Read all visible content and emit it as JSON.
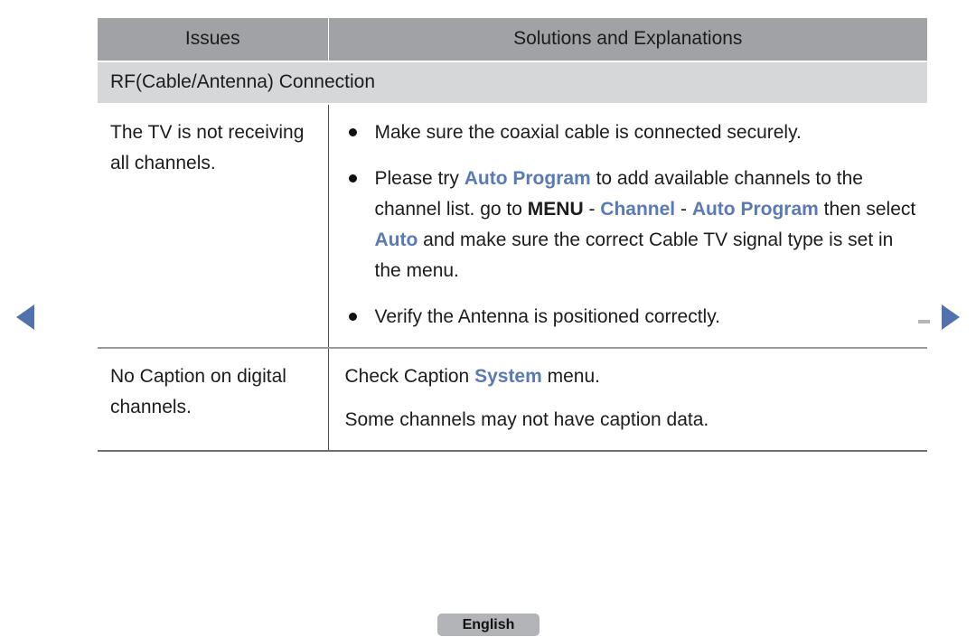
{
  "table": {
    "columns": [
      {
        "id": "issues",
        "label": "Issues"
      },
      {
        "id": "solutions",
        "label": "Solutions and Explanations"
      }
    ],
    "section_heading": "RF(Cable/Antenna) Connection",
    "rows": [
      {
        "issue": "The TV is not receiving all channels.",
        "solution_type": "bullets",
        "bullets": [
          {
            "segments": [
              {
                "text": "Make sure the coaxial cable is connected securely.",
                "style": "normal"
              }
            ]
          },
          {
            "segments": [
              {
                "text": "Please try ",
                "style": "normal"
              },
              {
                "text": "Auto Program",
                "style": "blue-bold"
              },
              {
                "text": " to add available channels to the channel list. go to ",
                "style": "normal"
              },
              {
                "text": "MENU",
                "style": "black-bold"
              },
              {
                "text": " - ",
                "style": "normal"
              },
              {
                "text": "Channel",
                "style": "blue-bold"
              },
              {
                "text": " - ",
                "style": "normal"
              },
              {
                "text": "Auto Program",
                "style": "blue-bold"
              },
              {
                "text": " then select ",
                "style": "normal"
              },
              {
                "text": "Auto",
                "style": "blue-bold"
              },
              {
                "text": " and make sure the correct Cable TV signal type is set in the menu.",
                "style": "normal"
              }
            ]
          },
          {
            "segments": [
              {
                "text": "Verify the Antenna is positioned correctly.",
                "style": "normal"
              }
            ]
          }
        ]
      },
      {
        "issue": "No Caption on digital channels.",
        "solution_type": "lines",
        "lines": [
          {
            "segments": [
              {
                "text": "Check Caption ",
                "style": "normal"
              },
              {
                "text": "System",
                "style": "blue-bold"
              },
              {
                "text": " menu.",
                "style": "normal"
              }
            ]
          },
          {
            "segments": [
              {
                "text": "Some channels may not have caption data.",
                "style": "normal"
              }
            ]
          }
        ]
      }
    ]
  },
  "navigation": {
    "prev_label": "◀",
    "next_label": "▶"
  },
  "footer": {
    "language_label": "English"
  },
  "colors": {
    "header_bg": "#a0a2a6",
    "subheader_bg": "#d6d7d9",
    "accent_blue": "#5a7ab5",
    "arrow_blue": "#5172ad",
    "button_bg": "#b3b4b7",
    "text": "#1c1c1c"
  }
}
